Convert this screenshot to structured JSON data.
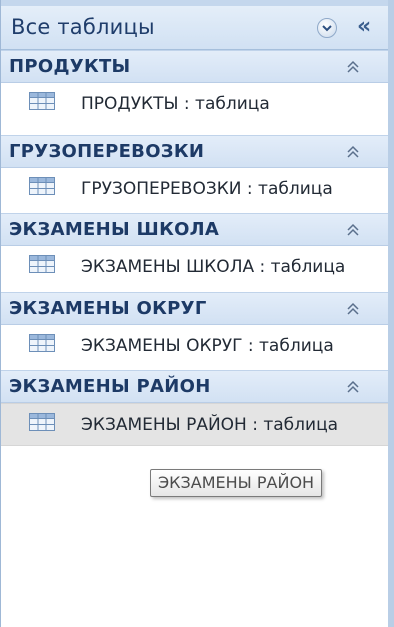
{
  "pane": {
    "title": "Все таблицы",
    "filter_icon": "chevron-down-circle-icon",
    "collapse_icon": "double-chevron-left-icon",
    "collapse_glyph": "«"
  },
  "groups": [
    {
      "title": "ПРОДУКТЫ",
      "item": "ПРОДУКТЫ : таблица"
    },
    {
      "title": "ГРУЗОПЕРЕВОЗКИ",
      "item": "ГРУЗОПЕРЕВОЗКИ : таблица"
    },
    {
      "title": "ЭКЗАМЕНЫ ШКОЛА",
      "item": "ЭКЗАМЕНЫ ШКОЛА : таблица"
    },
    {
      "title": "ЭКЗАМЕНЫ ОКРУГ",
      "item": "ЭКЗАМЕНЫ ОКРУГ : таблица"
    },
    {
      "title": "ЭКЗАМЕНЫ РАЙОН",
      "item": "ЭКЗАМЕНЫ РАЙОН : таблица"
    }
  ],
  "selected_item": "ЭКЗАМЕНЫ РАЙОН : таблица",
  "tooltip": "ЭКЗАМЕНЫ РАЙОН",
  "colors": {
    "header_text": "#1d3a66",
    "header_bg": "#d2e1f3",
    "selected_bg": "#e4e4e4"
  }
}
